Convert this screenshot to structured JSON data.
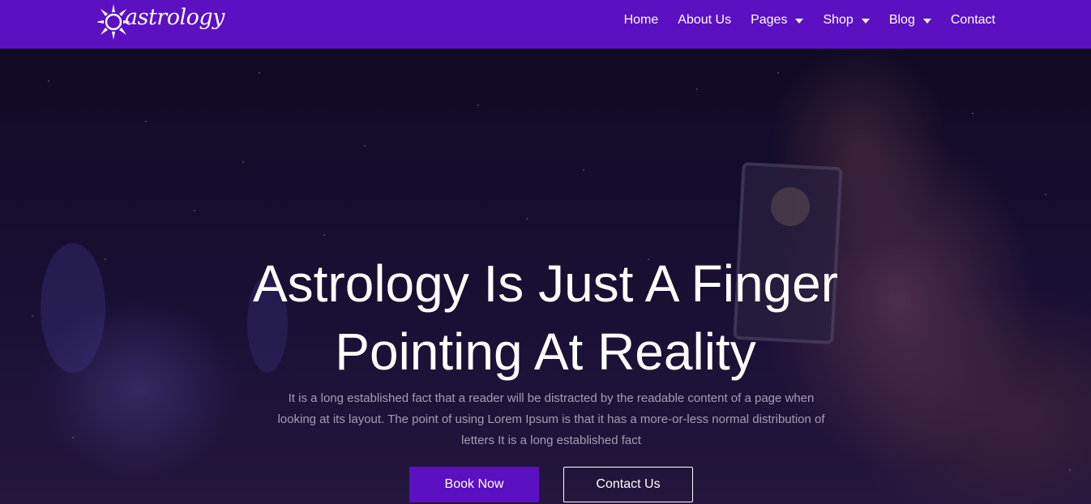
{
  "brand": {
    "logo_text": "astrology",
    "logo_icon": "sun-icon",
    "accent_color": "#5b10c2"
  },
  "nav": {
    "items": [
      {
        "label": "Home",
        "dropdown": false
      },
      {
        "label": "About Us",
        "dropdown": false
      },
      {
        "label": "Pages",
        "dropdown": true
      },
      {
        "label": "Shop",
        "dropdown": true
      },
      {
        "label": "Blog",
        "dropdown": true
      },
      {
        "label": "Contact",
        "dropdown": false
      }
    ]
  },
  "hero": {
    "title_line1": "Astrology Is Just A Finger",
    "title_line2": "Pointing At Reality",
    "description": "It is a long established fact that a reader will be distracted by the readable content of a page when looking at its layout. The point of using Lorem Ipsum is that it has a more-or-less normal distribution of letters It is a long established fact",
    "primary_button": "Book Now",
    "secondary_button": "Contact Us"
  }
}
